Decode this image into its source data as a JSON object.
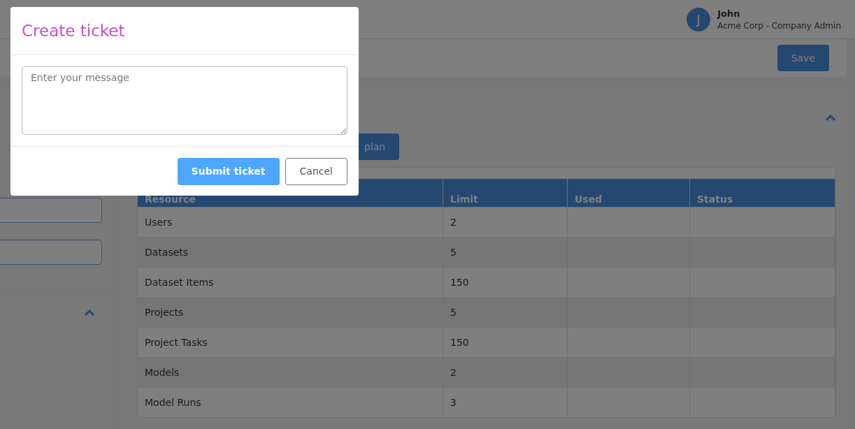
{
  "user": {
    "initial": "J",
    "name": "John",
    "role": "Acme Corp - Company Admin"
  },
  "toolbar": {
    "save_button": "Save"
  },
  "plan_panel": {
    "expanded": true,
    "plan_button": "plan",
    "table": {
      "columns": [
        "Resource",
        "Limit",
        "Used",
        "Status"
      ],
      "rows": [
        {
          "resource": "Users",
          "limit": "2"
        },
        {
          "resource": "Datasets",
          "limit": "5"
        },
        {
          "resource": "Dataset Items",
          "limit": "150"
        },
        {
          "resource": "Projects",
          "limit": "5"
        },
        {
          "resource": "Project Tasks",
          "limit": "150"
        },
        {
          "resource": "Models",
          "limit": "2"
        },
        {
          "resource": "Model Runs",
          "limit": "3"
        }
      ]
    }
  },
  "side_panel": {
    "expanded": true
  },
  "modal": {
    "title": "Create ticket",
    "message": {
      "placeholder": "Enter your message"
    },
    "buttons": [
      {
        "label": "Submit ticket",
        "kind": "primary"
      },
      {
        "label": "Cancel",
        "kind": "secondary"
      }
    ]
  }
}
